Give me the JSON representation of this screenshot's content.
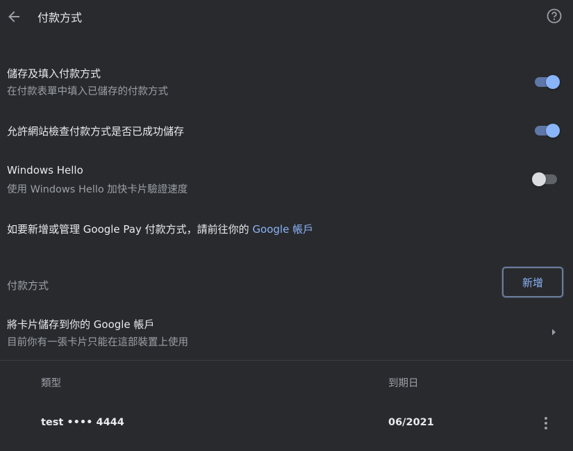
{
  "header": {
    "title": "付款方式",
    "back_icon": "arrow-back-icon",
    "help_icon": "help-circle-icon"
  },
  "settings": [
    {
      "title": "儲存及填入付款方式",
      "subtitle": "在付款表單中填入已儲存的付款方式",
      "enabled": true
    },
    {
      "title": "允許網站檢查付款方式是否已成功儲存",
      "enabled": true
    },
    {
      "title": "Windows Hello",
      "subtitle": "使用 Windows Hello 加快卡片驗證速度",
      "enabled": false
    }
  ],
  "google_pay": {
    "text": "如要新增或管理 Google Pay 付款方式，請前往你的",
    "link": "Google 帳戶"
  },
  "payment_methods": {
    "label": "付款方式",
    "add_label": "新增"
  },
  "save_card": {
    "title": "將卡片儲存到你的 Google 帳戶",
    "subtitle": "目前你有一張卡片只能在這部裝置上使用"
  },
  "card_table": {
    "columns": [
      "類型",
      "到期日"
    ],
    "rows": [
      {
        "type": "test •••• 4444",
        "expiry": "06/2021"
      }
    ]
  },
  "colors": {
    "background": "#292a2d",
    "accent": "#8ab4f8",
    "text_primary": "#e8eaed",
    "text_secondary": "#9aa0a6"
  }
}
